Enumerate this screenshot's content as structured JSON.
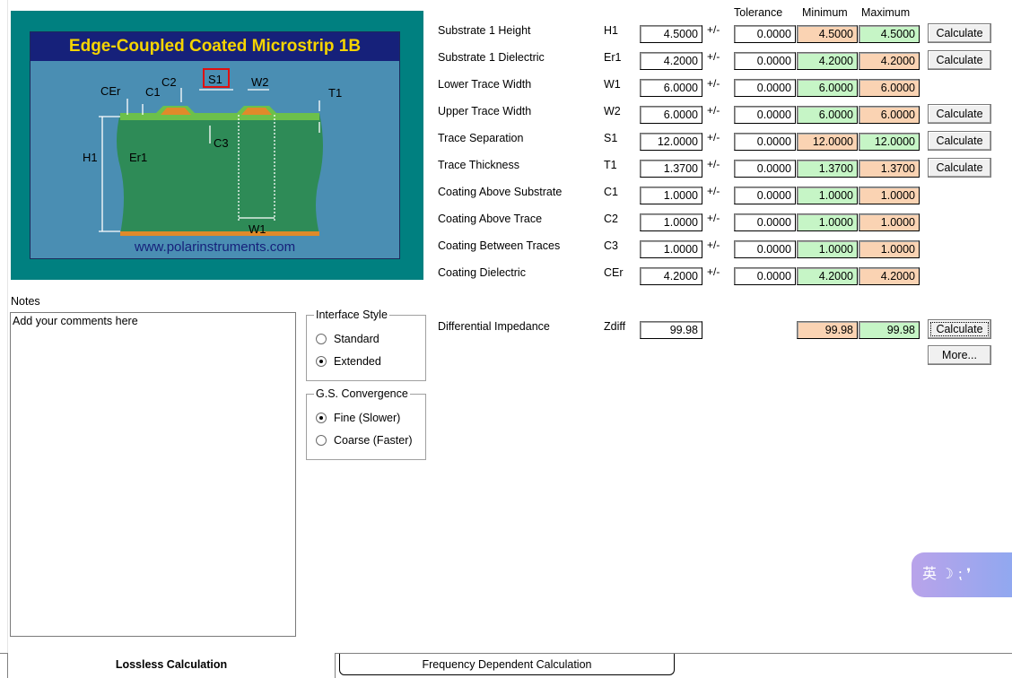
{
  "diagram": {
    "title": "Edge-Coupled Coated Microstrip 1B",
    "url": "www.polarinstruments.com",
    "labels": {
      "cer": "CEr",
      "c1": "C1",
      "c2": "C2",
      "s1": "S1",
      "w2": "W2",
      "t1": "T1",
      "c3": "C3",
      "h1": "H1",
      "er1": "Er1",
      "w1": "W1"
    },
    "colors": {
      "frame": "#008080",
      "background": "#4a8eb3",
      "title_bar": "#16217a",
      "title_text": "#f5d400",
      "substrate": "#2e8b57",
      "trace": "#e08a2a",
      "highlight": "#e01010"
    }
  },
  "table": {
    "headers": {
      "tolerance": "Tolerance",
      "minimum": "Minimum",
      "maximum": "Maximum"
    },
    "plusminus": "+/-",
    "rows": [
      {
        "label": "Substrate 1 Height",
        "symbol": "H1",
        "value": "4.5000",
        "tolerance": "0.0000",
        "minimum": "4.5000",
        "maximum": "4.5000",
        "min_color": "orange",
        "max_color": "green",
        "button": "Calculate"
      },
      {
        "label": "Substrate 1 Dielectric",
        "symbol": "Er1",
        "value": "4.2000",
        "tolerance": "0.0000",
        "minimum": "4.2000",
        "maximum": "4.2000",
        "min_color": "green",
        "max_color": "orange",
        "button": "Calculate"
      },
      {
        "label": "Lower Trace Width",
        "symbol": "W1",
        "value": "6.0000",
        "tolerance": "0.0000",
        "minimum": "6.0000",
        "maximum": "6.0000",
        "min_color": "green",
        "max_color": "orange",
        "button": ""
      },
      {
        "label": "Upper Trace Width",
        "symbol": "W2",
        "value": "6.0000",
        "tolerance": "0.0000",
        "minimum": "6.0000",
        "maximum": "6.0000",
        "min_color": "green",
        "max_color": "orange",
        "button": "Calculate"
      },
      {
        "label": "Trace Separation",
        "symbol": "S1",
        "value": "12.0000",
        "tolerance": "0.0000",
        "minimum": "12.0000",
        "maximum": "12.0000",
        "min_color": "orange",
        "max_color": "green",
        "button": "Calculate"
      },
      {
        "label": "Trace Thickness",
        "symbol": "T1",
        "value": "1.3700",
        "tolerance": "0.0000",
        "minimum": "1.3700",
        "maximum": "1.3700",
        "min_color": "green",
        "max_color": "orange",
        "button": "Calculate"
      },
      {
        "label": "Coating Above Substrate",
        "symbol": "C1",
        "value": "1.0000",
        "tolerance": "0.0000",
        "minimum": "1.0000",
        "maximum": "1.0000",
        "min_color": "green",
        "max_color": "orange",
        "button": ""
      },
      {
        "label": "Coating Above Trace",
        "symbol": "C2",
        "value": "1.0000",
        "tolerance": "0.0000",
        "minimum": "1.0000",
        "maximum": "1.0000",
        "min_color": "green",
        "max_color": "orange",
        "button": ""
      },
      {
        "label": "Coating Between Traces",
        "symbol": "C3",
        "value": "1.0000",
        "tolerance": "0.0000",
        "minimum": "1.0000",
        "maximum": "1.0000",
        "min_color": "green",
        "max_color": "orange",
        "button": ""
      },
      {
        "label": "Coating Dielectric",
        "symbol": "CEr",
        "value": "4.2000",
        "tolerance": "0.0000",
        "minimum": "4.2000",
        "maximum": "4.2000",
        "min_color": "green",
        "max_color": "orange",
        "button": ""
      }
    ]
  },
  "result": {
    "label": "Differential Impedance",
    "symbol": "Zdiff",
    "value": "99.98",
    "minimum": "99.98",
    "maximum": "99.98",
    "calculate_button": "Calculate",
    "more_button": "More..."
  },
  "notes": {
    "label": "Notes",
    "value": "Add your comments here"
  },
  "interface_style": {
    "title": "Interface Style",
    "options": [
      {
        "label": "Standard",
        "selected": false
      },
      {
        "label": "Extended",
        "selected": true
      }
    ]
  },
  "convergence": {
    "title": "G.S. Convergence",
    "options": [
      {
        "label": "Fine (Slower)",
        "selected": true
      },
      {
        "label": "Coarse (Faster)",
        "selected": false
      }
    ]
  },
  "tabs": [
    {
      "label": "Lossless Calculation",
      "active": true
    },
    {
      "label": "Frequency Dependent Calculation",
      "active": false
    }
  ],
  "ime": {
    "text": "英 ☽ ⁏ ❜"
  },
  "colors": {
    "field_green": "#c6f5c6",
    "field_orange": "#fad3b3"
  }
}
